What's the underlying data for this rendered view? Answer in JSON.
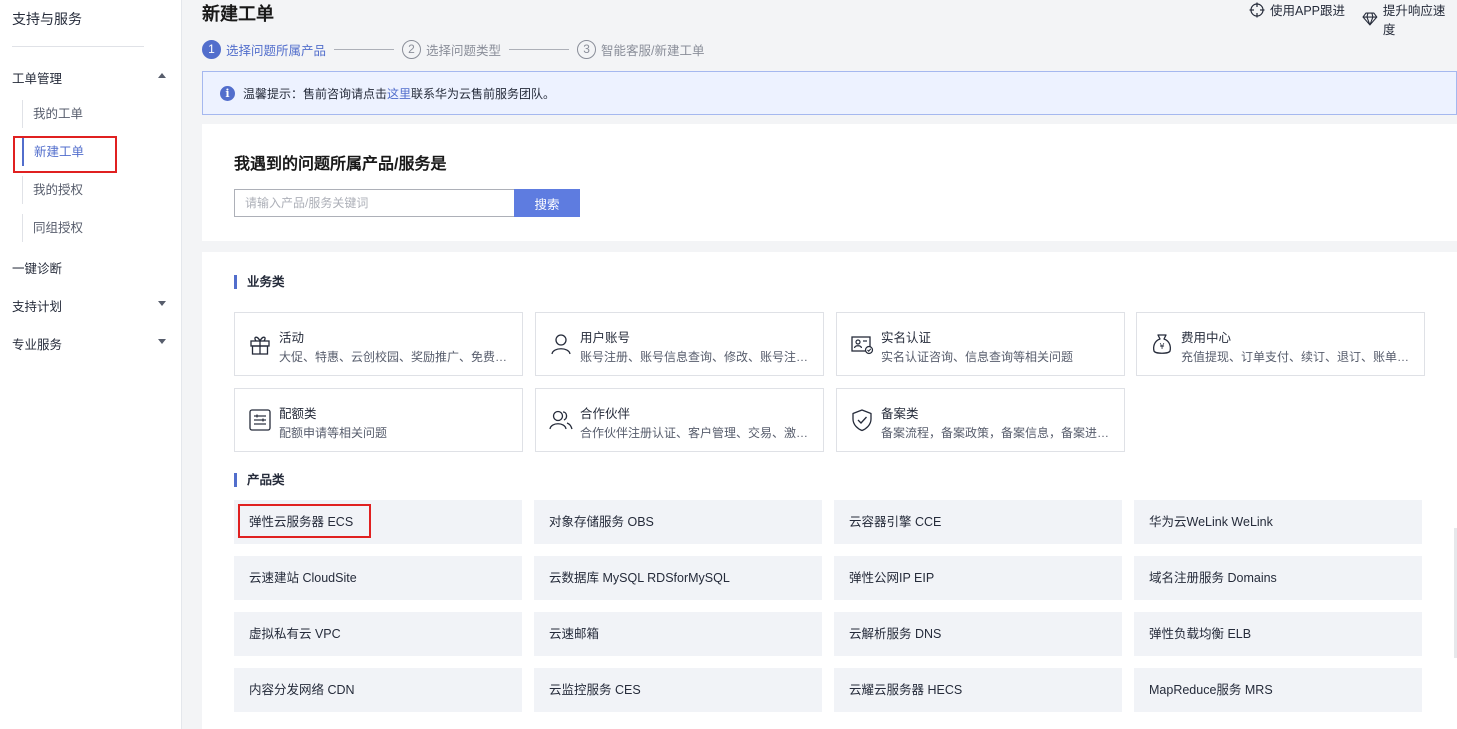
{
  "sidebar": {
    "title": "支持与服务",
    "groups": [
      {
        "label": "工单管理",
        "expanded": true
      },
      {
        "label": "一键诊断"
      },
      {
        "label": "支持计划",
        "expanded": false
      },
      {
        "label": "专业服务",
        "expanded": false
      }
    ],
    "sub_items": [
      {
        "label": "我的工单"
      },
      {
        "label": "新建工单",
        "active": true
      },
      {
        "label": "我的授权"
      },
      {
        "label": "同组授权"
      }
    ]
  },
  "header": {
    "title": "新建工单",
    "links": [
      {
        "label": "使用APP跟进",
        "icon": "crosshair-icon"
      },
      {
        "label": "提升响应速度",
        "icon": "diamond-icon"
      }
    ]
  },
  "steps": [
    {
      "num": "1",
      "label": "选择问题所属产品",
      "active": true
    },
    {
      "num": "2",
      "label": "选择问题类型",
      "active": false
    },
    {
      "num": "3",
      "label": "智能客服/新建工单",
      "active": false
    }
  ],
  "notice": {
    "prefix": "温馨提示：售前咨询请点击",
    "link": "这里",
    "suffix": "联系华为云售前服务团队。"
  },
  "search": {
    "heading": "我遇到的问题所属产品/服务是",
    "placeholder": "请输入产品/服务关键词",
    "button": "搜索"
  },
  "business": {
    "heading": "业务类",
    "tiles": [
      {
        "title": "活动",
        "desc": "大促、特惠、云创校园、奖励推广、免费试用等相关问题",
        "icon": "gift-icon"
      },
      {
        "title": "用户账号",
        "desc": "账号注册、账号信息查询、修改、账号注销等相关问题",
        "icon": "user-icon"
      },
      {
        "title": "实名认证",
        "desc": "实名认证咨询、信息查询等相关问题",
        "icon": "id-card-icon"
      },
      {
        "title": "费用中心",
        "desc": "充值提现、订单支付、续订、退订、账单查询等相关问题",
        "icon": "money-bag-icon"
      },
      {
        "title": "配额类",
        "desc": "配额申请等相关问题",
        "icon": "quota-list-icon"
      },
      {
        "title": "合作伙伴",
        "desc": "合作伙伴注册认证、客户管理、交易、激励等相关问题",
        "icon": "partner-icon"
      },
      {
        "title": "备案类",
        "desc": "备案流程，备案政策，备案信息，备案进度等相关问题",
        "icon": "shield-check-icon"
      }
    ]
  },
  "products": {
    "heading": "产品类",
    "items": [
      "弹性云服务器 ECS",
      "对象存储服务 OBS",
      "云容器引擎 CCE",
      "华为云WeLink WeLink",
      "云速建站 CloudSite",
      "云数据库 MySQL RDSforMySQL",
      "弹性公网IP EIP",
      "域名注册服务 Domains",
      "虚拟私有云 VPC",
      "云速邮箱",
      "云解析服务 DNS",
      "弹性负载均衡 ELB",
      "内容分发网络 CDN",
      "云监控服务 CES",
      "云耀云服务器 HECS",
      "MapReduce服务 MRS"
    ]
  },
  "colors": {
    "accent": "#526ecc",
    "highlight": "#e02020"
  }
}
